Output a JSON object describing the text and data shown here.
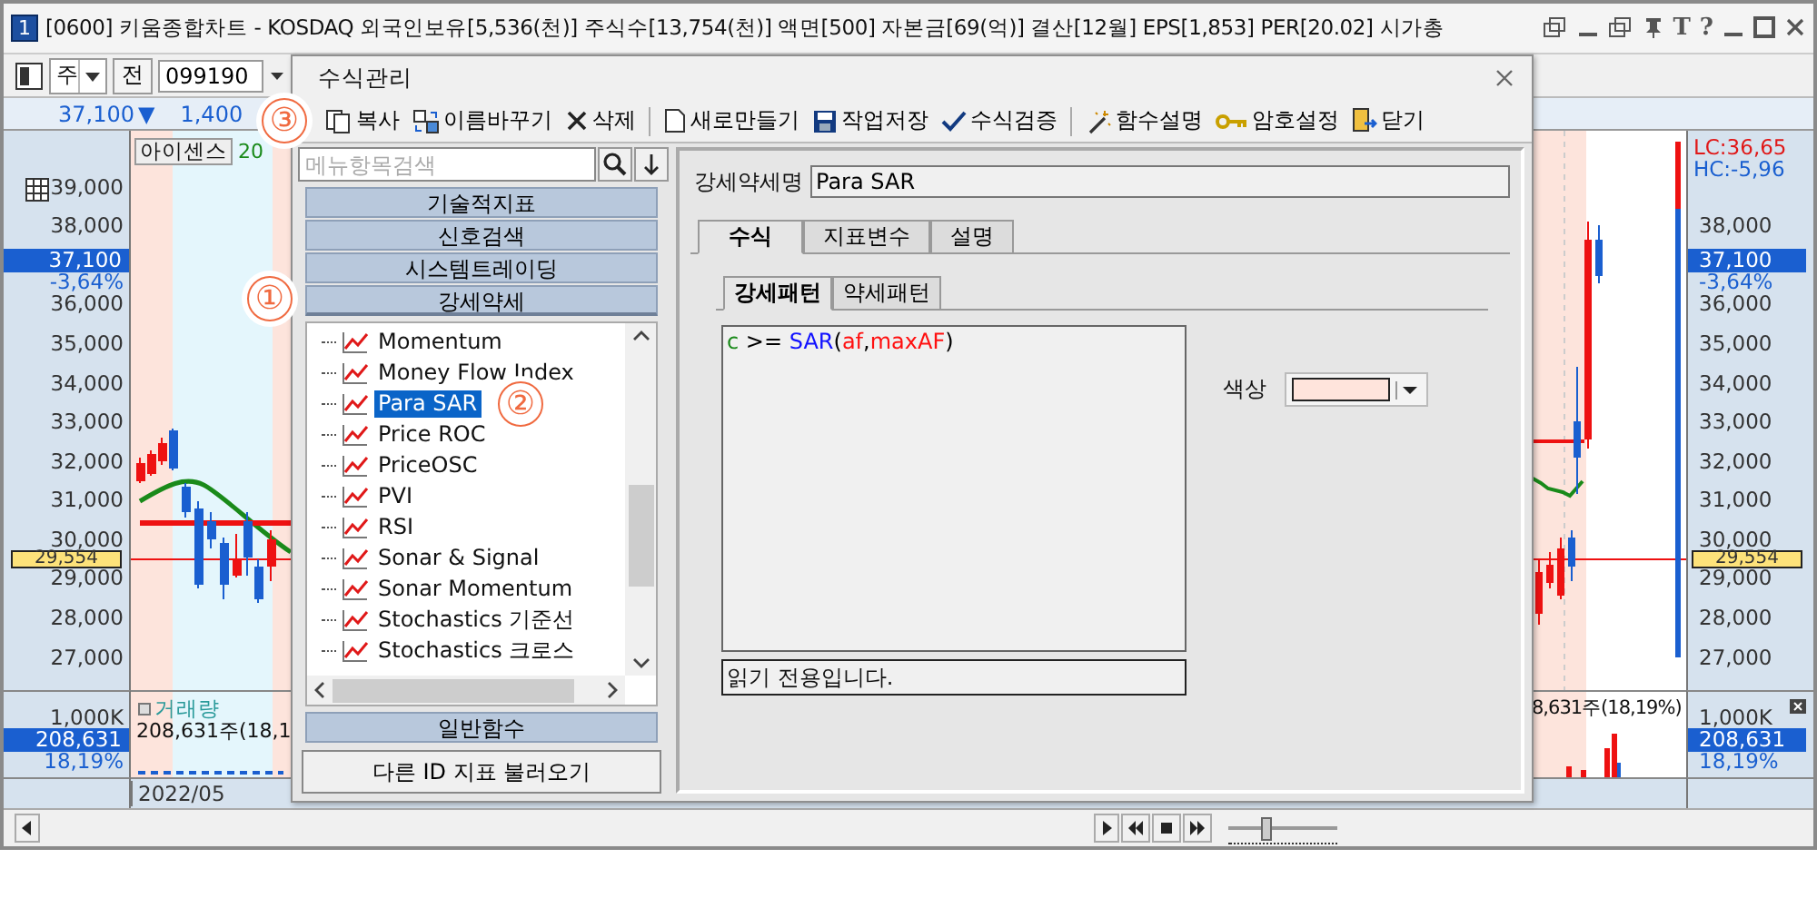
{
  "window": {
    "number": "1",
    "title": "[0600] 키움종합차트 - KOSDAQ 외국인보유[5,536(천)] 주식수[13,754(천)] 액면[500] 자본금[69(억)] 결산[12월] EPS[1,853] PER[20.02] 시가총",
    "title_buttons": [
      "T",
      "?"
    ]
  },
  "toolbar": {
    "period": "주",
    "prev_button": "전",
    "code": "099190"
  },
  "price_row": {
    "price": "37,100",
    "direction": "▼",
    "change": "1,400"
  },
  "chart": {
    "legend": "아이센스",
    "legend_extra": "20",
    "left_crosshair": "29,554",
    "right_crosshair": "29,554",
    "left_axis": [
      {
        "kind": "tick",
        "text": "39,000"
      },
      {
        "kind": "tick",
        "text": "38,000"
      },
      {
        "kind": "price",
        "text": "37,100",
        "change": "-3,64%"
      },
      {
        "kind": "tick",
        "text": "36,000"
      },
      {
        "kind": "tick",
        "text": "35,000"
      },
      {
        "kind": "tick",
        "text": "34,000"
      },
      {
        "kind": "tick",
        "text": "33,000"
      },
      {
        "kind": "tick",
        "text": "32,000"
      },
      {
        "kind": "tick",
        "text": "31,000"
      },
      {
        "kind": "tick",
        "text": "30,000"
      },
      {
        "kind": "tick",
        "text": "29,000"
      },
      {
        "kind": "tick",
        "text": "28,000"
      },
      {
        "kind": "tick",
        "text": "27,000"
      }
    ],
    "right_legend": [
      {
        "text": "LC:36,65",
        "color": "#e01818"
      },
      {
        "text": "HC:-5,96",
        "color": "#1a5fd0"
      }
    ],
    "right_axis": [
      {
        "kind": "tick",
        "text": "38,000"
      },
      {
        "kind": "price",
        "text": "37,100",
        "change": "-3,64%"
      },
      {
        "kind": "tick",
        "text": "36,000"
      },
      {
        "kind": "tick",
        "text": "35,000"
      },
      {
        "kind": "tick",
        "text": "34,000"
      },
      {
        "kind": "tick",
        "text": "33,000"
      },
      {
        "kind": "tick",
        "text": "32,000"
      },
      {
        "kind": "tick",
        "text": "31,000"
      },
      {
        "kind": "tick",
        "text": "30,000"
      },
      {
        "kind": "tick",
        "text": "29,000"
      },
      {
        "kind": "tick",
        "text": "28,000"
      },
      {
        "kind": "tick",
        "text": "27,000"
      }
    ],
    "volume": {
      "label": "거래량",
      "left_value": "208,631주(18,1",
      "right_value": "8,631주(18,19%)",
      "left_axis": {
        "tick": "1,000K",
        "value": "208,631",
        "percent": "18,19%"
      },
      "right_axis": {
        "tick": "1,000K",
        "value": "208,631",
        "percent": "18,19%"
      }
    },
    "date": "2022/05"
  },
  "playback": {
    "zoom_slider": {
      "level": 0.35
    }
  },
  "dialog": {
    "title": "수식관리",
    "tools": [
      {
        "kind": "copy",
        "label": "복사"
      },
      {
        "kind": "rename",
        "label": "이름바꾸기"
      },
      {
        "kind": "delete",
        "label": "삭제"
      },
      {
        "kind": "new",
        "label": "새로만들기"
      },
      {
        "kind": "save",
        "label": "작업저장"
      },
      {
        "kind": "verify",
        "label": "수식검증"
      },
      {
        "kind": "wand",
        "label": "함수설명"
      },
      {
        "kind": "key",
        "label": "암호설정"
      },
      {
        "kind": "exit",
        "label": "닫기"
      }
    ],
    "search": {
      "placeholder": "메뉴항목검색"
    },
    "categories": [
      {
        "label": "기술적지표",
        "expanded": false
      },
      {
        "label": "신호검색",
        "expanded": false
      },
      {
        "label": "시스템트레이딩",
        "expanded": false
      },
      {
        "label": "강세약세",
        "expanded": true
      },
      {
        "label": "일반함수",
        "expanded": false
      }
    ],
    "tree_items": [
      {
        "label": "Momentum",
        "selected": false
      },
      {
        "label": "Money Flow Index",
        "selected": false
      },
      {
        "label": "Para SAR",
        "selected": true
      },
      {
        "label": "Price ROC",
        "selected": false
      },
      {
        "label": "PriceOSC",
        "selected": false
      },
      {
        "label": "PVI",
        "selected": false
      },
      {
        "label": "RSI",
        "selected": false
      },
      {
        "label": "Sonar & Signal",
        "selected": false
      },
      {
        "label": "Sonar Momentum",
        "selected": false
      },
      {
        "label": "Stochastics 기준선",
        "selected": false
      },
      {
        "label": "Stochastics 크로스",
        "selected": false
      }
    ],
    "load_button": "다른 ID 지표 불러오기",
    "name_label": "강세약세명",
    "name_value": "Para SAR",
    "tabs": [
      {
        "label": "수식",
        "selected": true
      },
      {
        "label": "지표변수",
        "selected": false
      },
      {
        "label": "설명",
        "selected": false
      }
    ],
    "subtabs": [
      {
        "label": "강세패턴",
        "selected": true
      },
      {
        "label": "약세패턴",
        "selected": false
      }
    ],
    "formula": [
      {
        "text": "c",
        "kind": "variable"
      },
      {
        "text": " >= ",
        "kind": "operator"
      },
      {
        "text": "SAR",
        "kind": "function"
      },
      {
        "text": "(",
        "kind": "operator"
      },
      {
        "text": "af",
        "kind": "param"
      },
      {
        "text": ",",
        "kind": "operator"
      },
      {
        "text": "maxAF",
        "kind": "param"
      },
      {
        "text": ")",
        "kind": "operator"
      }
    ],
    "status": "읽기 전용입니다.",
    "color_label": "색상",
    "color": "#ffe4dc"
  },
  "annotations": [
    "①",
    "②",
    "③"
  ]
}
